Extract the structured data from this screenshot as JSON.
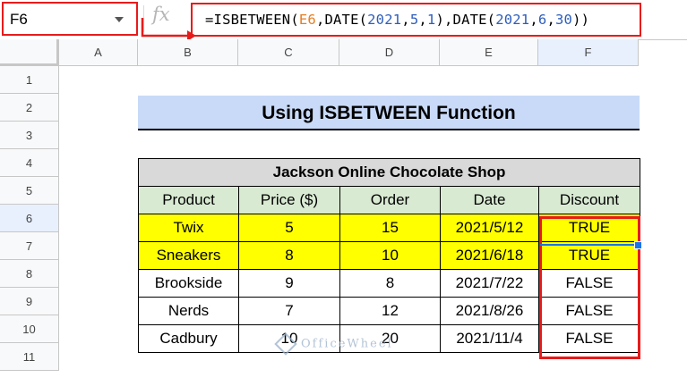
{
  "namebox": {
    "value": "F6"
  },
  "formula_bar": {
    "fx_label": "fx",
    "formula_parts": [
      {
        "text": "=ISBETWEEN(",
        "kind": "plain"
      },
      {
        "text": "E6",
        "kind": "ref"
      },
      {
        "text": ",DATE(",
        "kind": "plain"
      },
      {
        "text": "2021",
        "kind": "num"
      },
      {
        "text": ",",
        "kind": "plain"
      },
      {
        "text": "5",
        "kind": "num"
      },
      {
        "text": ",",
        "kind": "plain"
      },
      {
        "text": "1",
        "kind": "num"
      },
      {
        "text": "),DATE(",
        "kind": "plain"
      },
      {
        "text": "2021",
        "kind": "num"
      },
      {
        "text": ",",
        "kind": "plain"
      },
      {
        "text": "6",
        "kind": "num"
      },
      {
        "text": ",",
        "kind": "plain"
      },
      {
        "text": "30",
        "kind": "num"
      },
      {
        "text": "))",
        "kind": "plain"
      }
    ]
  },
  "columns": [
    "A",
    "B",
    "C",
    "D",
    "E",
    "F"
  ],
  "rows": [
    "1",
    "2",
    "3",
    "4",
    "5",
    "6",
    "7",
    "8",
    "9",
    "10",
    "11"
  ],
  "selected_cell": {
    "column": "F",
    "row": "6"
  },
  "banner": {
    "title": "Using ISBETWEEN Function"
  },
  "table": {
    "title": "Jackson Online Chocolate Shop",
    "headers": [
      "Product",
      "Price ($)",
      "Order",
      "Date",
      "Discount"
    ],
    "rows": [
      [
        "Twix",
        "5",
        "15",
        "2021/5/12",
        "TRUE"
      ],
      [
        "Sneakers",
        "8",
        "10",
        "2021/6/18",
        "TRUE"
      ],
      [
        "Brookside",
        "9",
        "8",
        "2021/7/22",
        "FALSE"
      ],
      [
        "Nerds",
        "7",
        "12",
        "2021/8/26",
        "FALSE"
      ],
      [
        "Cadbury",
        "10",
        "20",
        "2021/11/4",
        "FALSE"
      ]
    ],
    "highlighted_rows": [
      0,
      1
    ]
  },
  "watermark": {
    "text": "OfficeWheel"
  },
  "colors": {
    "highlight_red": "#e81b1b",
    "selection_blue": "#1a73e8",
    "banner_bg": "#c9daf8",
    "title_bg": "#d9d9d9",
    "header_bg": "#d9ead3",
    "row_highlight": "#ffff00"
  }
}
